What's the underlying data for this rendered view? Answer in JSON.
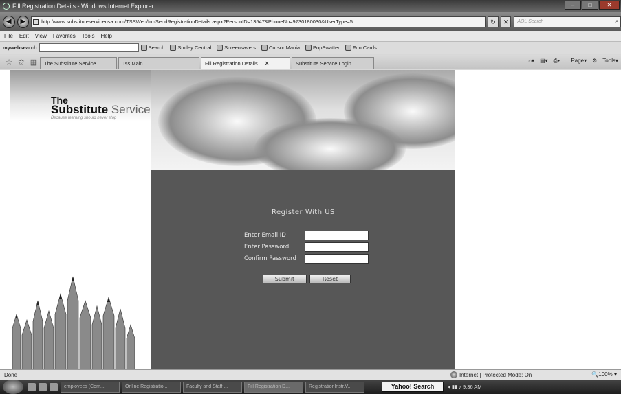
{
  "window": {
    "title": "Fill Registration Details - Windows Internet Explorer"
  },
  "address": {
    "url": "http://www.substituteserviceusa.com/TSSWeb/frmSendRegistrationDetails.aspx?PersonID=13547&PhoneNo=9730180030&UserType=5",
    "search_placeholder": "AOL Search"
  },
  "menu": [
    "File",
    "Edit",
    "View",
    "Favorites",
    "Tools",
    "Help"
  ],
  "toolbar2": {
    "mywebsearch": "mywebsearch",
    "search": "Search",
    "items": [
      "Smiley Central",
      "Screensavers",
      "Cursor Mania",
      "PopSwatter",
      "Fun Cards"
    ]
  },
  "tabs": [
    {
      "label": "The Substitute Service"
    },
    {
      "label": "Tss Main"
    },
    {
      "label": "Fill Registration Details"
    },
    {
      "label": "Substitute Service Login"
    }
  ],
  "tabtools": {
    "page": "Page",
    "tools": "Tools"
  },
  "logo": {
    "the": "The",
    "word1": "Substitute",
    "word2": "Service",
    "tagline": "Because learning should never stop"
  },
  "form": {
    "heading": "Register With US",
    "email_label": "Enter Email ID",
    "password_label": "Enter Password",
    "confirm_label": "Confirm Password",
    "submit": "Submit",
    "reset": "Reset"
  },
  "status": {
    "left": "Done",
    "zone": "Internet | Protected Mode: On",
    "zoom": "100%"
  },
  "taskbar": {
    "tasks": [
      "employees (Com...",
      "Online Registratio...",
      "Faculty and Staff ...",
      "Fill Registration D...",
      "RegistrationInstr.V..."
    ],
    "search": "Yahoo! Search",
    "clock": "9:36 AM"
  }
}
